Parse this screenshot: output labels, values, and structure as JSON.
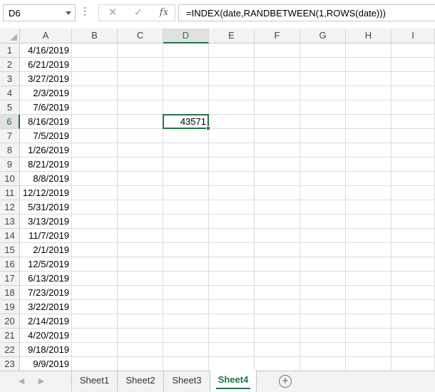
{
  "namebox": {
    "value": "D6"
  },
  "formula_bar": {
    "cancel_icon": "x-icon",
    "enter_icon": "check-icon",
    "fx_label": "fx",
    "formula": "=INDEX(date,RANDBETWEEN(1,ROWS(date)))"
  },
  "columns": [
    "A",
    "B",
    "C",
    "D",
    "E",
    "F",
    "G",
    "H",
    "I"
  ],
  "selected_column": "D",
  "selected_row": "6",
  "rows": [
    "1",
    "2",
    "3",
    "4",
    "5",
    "6",
    "7",
    "8",
    "9",
    "10",
    "11",
    "12",
    "13",
    "14",
    "15",
    "16",
    "17",
    "18",
    "19",
    "20",
    "21",
    "22",
    "23"
  ],
  "column_a": [
    "4/16/2019",
    "6/21/2019",
    "3/27/2019",
    "2/3/2019",
    "7/6/2019",
    "8/16/2019",
    "7/5/2019",
    "1/26/2019",
    "8/21/2019",
    "8/8/2019",
    "12/12/2019",
    "5/31/2019",
    "3/13/2019",
    "11/7/2019",
    "2/1/2019",
    "12/5/2019",
    "6/13/2019",
    "7/23/2019",
    "3/22/2019",
    "2/14/2019",
    "4/20/2019",
    "9/18/2019",
    "9/9/2019"
  ],
  "d6_value": "43571",
  "sheet_tabs": [
    "Sheet1",
    "Sheet2",
    "Sheet3",
    "Sheet4"
  ],
  "active_tab": "Sheet4",
  "add_sheet_label": "+",
  "nav_prev": "◀",
  "nav_next": "▶",
  "accent_color": "#217346"
}
